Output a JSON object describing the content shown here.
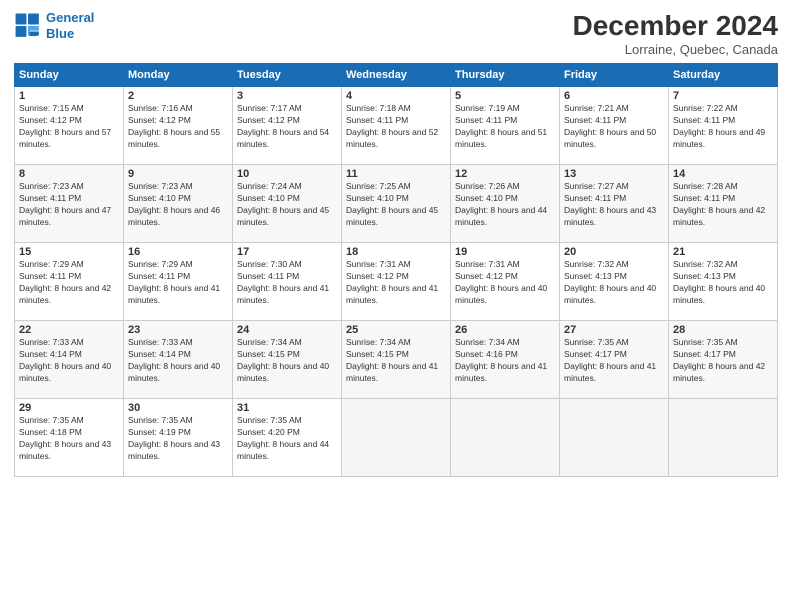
{
  "header": {
    "logo_line1": "General",
    "logo_line2": "Blue",
    "month": "December 2024",
    "location": "Lorraine, Quebec, Canada"
  },
  "days_of_week": [
    "Sunday",
    "Monday",
    "Tuesday",
    "Wednesday",
    "Thursday",
    "Friday",
    "Saturday"
  ],
  "weeks": [
    [
      {
        "day": 1,
        "sunrise": "7:15 AM",
        "sunset": "4:12 PM",
        "daylight": "8 hours and 57 minutes."
      },
      {
        "day": 2,
        "sunrise": "7:16 AM",
        "sunset": "4:12 PM",
        "daylight": "8 hours and 55 minutes."
      },
      {
        "day": 3,
        "sunrise": "7:17 AM",
        "sunset": "4:12 PM",
        "daylight": "8 hours and 54 minutes."
      },
      {
        "day": 4,
        "sunrise": "7:18 AM",
        "sunset": "4:11 PM",
        "daylight": "8 hours and 52 minutes."
      },
      {
        "day": 5,
        "sunrise": "7:19 AM",
        "sunset": "4:11 PM",
        "daylight": "8 hours and 51 minutes."
      },
      {
        "day": 6,
        "sunrise": "7:21 AM",
        "sunset": "4:11 PM",
        "daylight": "8 hours and 50 minutes."
      },
      {
        "day": 7,
        "sunrise": "7:22 AM",
        "sunset": "4:11 PM",
        "daylight": "8 hours and 49 minutes."
      }
    ],
    [
      {
        "day": 8,
        "sunrise": "7:23 AM",
        "sunset": "4:11 PM",
        "daylight": "8 hours and 47 minutes."
      },
      {
        "day": 9,
        "sunrise": "7:23 AM",
        "sunset": "4:10 PM",
        "daylight": "8 hours and 46 minutes."
      },
      {
        "day": 10,
        "sunrise": "7:24 AM",
        "sunset": "4:10 PM",
        "daylight": "8 hours and 45 minutes."
      },
      {
        "day": 11,
        "sunrise": "7:25 AM",
        "sunset": "4:10 PM",
        "daylight": "8 hours and 45 minutes."
      },
      {
        "day": 12,
        "sunrise": "7:26 AM",
        "sunset": "4:10 PM",
        "daylight": "8 hours and 44 minutes."
      },
      {
        "day": 13,
        "sunrise": "7:27 AM",
        "sunset": "4:11 PM",
        "daylight": "8 hours and 43 minutes."
      },
      {
        "day": 14,
        "sunrise": "7:28 AM",
        "sunset": "4:11 PM",
        "daylight": "8 hours and 42 minutes."
      }
    ],
    [
      {
        "day": 15,
        "sunrise": "7:29 AM",
        "sunset": "4:11 PM",
        "daylight": "8 hours and 42 minutes."
      },
      {
        "day": 16,
        "sunrise": "7:29 AM",
        "sunset": "4:11 PM",
        "daylight": "8 hours and 41 minutes."
      },
      {
        "day": 17,
        "sunrise": "7:30 AM",
        "sunset": "4:11 PM",
        "daylight": "8 hours and 41 minutes."
      },
      {
        "day": 18,
        "sunrise": "7:31 AM",
        "sunset": "4:12 PM",
        "daylight": "8 hours and 41 minutes."
      },
      {
        "day": 19,
        "sunrise": "7:31 AM",
        "sunset": "4:12 PM",
        "daylight": "8 hours and 40 minutes."
      },
      {
        "day": 20,
        "sunrise": "7:32 AM",
        "sunset": "4:13 PM",
        "daylight": "8 hours and 40 minutes."
      },
      {
        "day": 21,
        "sunrise": "7:32 AM",
        "sunset": "4:13 PM",
        "daylight": "8 hours and 40 minutes."
      }
    ],
    [
      {
        "day": 22,
        "sunrise": "7:33 AM",
        "sunset": "4:14 PM",
        "daylight": "8 hours and 40 minutes."
      },
      {
        "day": 23,
        "sunrise": "7:33 AM",
        "sunset": "4:14 PM",
        "daylight": "8 hours and 40 minutes."
      },
      {
        "day": 24,
        "sunrise": "7:34 AM",
        "sunset": "4:15 PM",
        "daylight": "8 hours and 40 minutes."
      },
      {
        "day": 25,
        "sunrise": "7:34 AM",
        "sunset": "4:15 PM",
        "daylight": "8 hours and 41 minutes."
      },
      {
        "day": 26,
        "sunrise": "7:34 AM",
        "sunset": "4:16 PM",
        "daylight": "8 hours and 41 minutes."
      },
      {
        "day": 27,
        "sunrise": "7:35 AM",
        "sunset": "4:17 PM",
        "daylight": "8 hours and 41 minutes."
      },
      {
        "day": 28,
        "sunrise": "7:35 AM",
        "sunset": "4:17 PM",
        "daylight": "8 hours and 42 minutes."
      }
    ],
    [
      {
        "day": 29,
        "sunrise": "7:35 AM",
        "sunset": "4:18 PM",
        "daylight": "8 hours and 43 minutes."
      },
      {
        "day": 30,
        "sunrise": "7:35 AM",
        "sunset": "4:19 PM",
        "daylight": "8 hours and 43 minutes."
      },
      {
        "day": 31,
        "sunrise": "7:35 AM",
        "sunset": "4:20 PM",
        "daylight": "8 hours and 44 minutes."
      },
      null,
      null,
      null,
      null
    ]
  ]
}
